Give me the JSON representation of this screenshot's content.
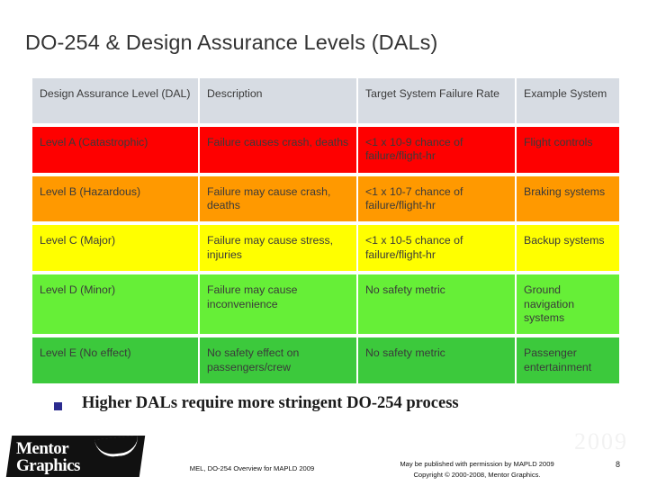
{
  "slide": {
    "title": "DO-254 & Design Assurance Levels (DALs)",
    "table": {
      "headers": [
        "Design Assurance Level (DAL)",
        "Description",
        "Target System Failure Rate",
        "Example System"
      ],
      "rows": [
        {
          "level": "Level A (Catastrophic)",
          "description": "Failure causes crash, deaths",
          "failure_rate": "<1 x 10-9 chance of failure/flight-hr",
          "example": "Flight controls",
          "color": "#fe0000"
        },
        {
          "level": "Level B (Hazardous)",
          "description": "Failure may cause crash, deaths",
          "failure_rate": "<1 x 10-7 chance of failure/flight-hr",
          "example": "Braking systems",
          "color": "#ff9900"
        },
        {
          "level": "Level C (Major)",
          "description": "Failure may cause stress, injuries",
          "failure_rate": "<1 x 10-5 chance of failure/flight-hr",
          "example": "Backup systems",
          "color": "#ffff00"
        },
        {
          "level": "Level D (Minor)",
          "description": "Failure may cause inconvenience",
          "failure_rate": "No safety metric",
          "example": "Ground navigation systems",
          "color": "#66ef37"
        },
        {
          "level": "Level E (No effect)",
          "description": "No safety effect on passengers/crew",
          "failure_rate": "No safety metric",
          "example": "Passenger entertainment",
          "color": "#3cc93c"
        }
      ]
    },
    "bullet": "Higher DALs require more stringent DO-254 process",
    "footer": {
      "logo_line1": "Mentor",
      "logo_line2": "Graphics",
      "center_left": "MEL, DO-254 Overview for MAPLD 2009",
      "center_right_line1": "May be published with permission by MAPLD 2009",
      "center_right_line2": "Copyright © 2000-2008, Mentor Graphics.",
      "page_number": "8",
      "watermark": "2009"
    }
  }
}
